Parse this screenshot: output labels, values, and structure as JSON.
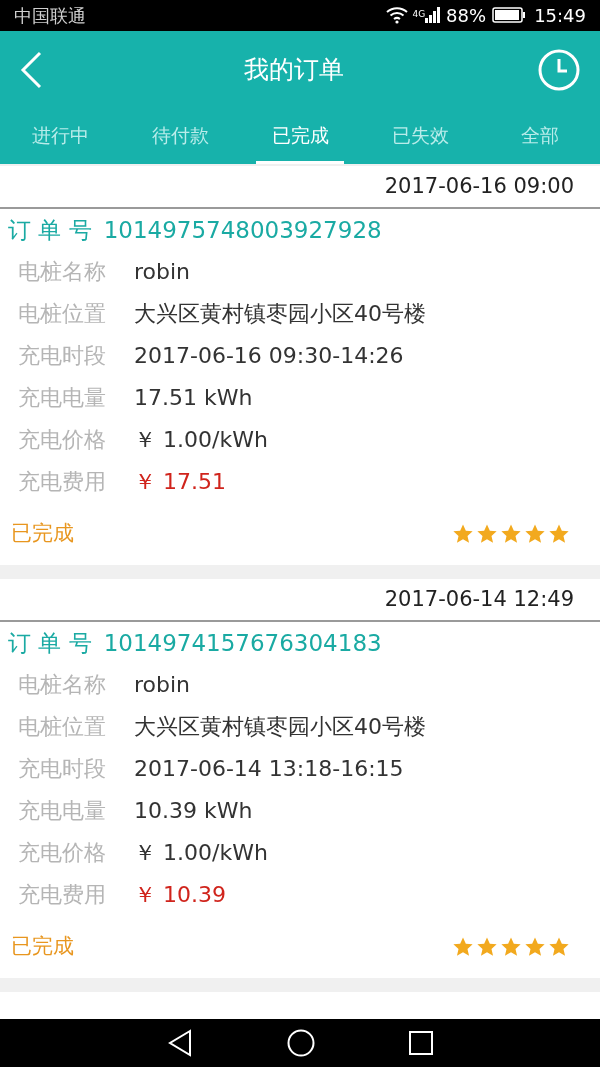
{
  "status_bar": {
    "carrier": "中国联通",
    "network": "4G",
    "battery": "88%",
    "time": "15:49"
  },
  "header": {
    "title": "我的订单"
  },
  "tabs": [
    {
      "label": "进行中",
      "selected": false
    },
    {
      "label": "待付款",
      "selected": false
    },
    {
      "label": "已完成",
      "selected": true
    },
    {
      "label": "已失效",
      "selected": false
    },
    {
      "label": "全部",
      "selected": false
    }
  ],
  "orders": [
    {
      "date": "2017-06-16 09:00",
      "order_label": "订 单 号",
      "order_number": "1014975748003927928",
      "fields": [
        {
          "label": "电桩名称",
          "value": "robin",
          "kind": "text"
        },
        {
          "label": "电桩位置",
          "value": "大兴区黄村镇枣园小区40号楼",
          "kind": "text"
        },
        {
          "label": "充电时段",
          "value": "2017-06-16 09:30-14:26",
          "kind": "text"
        },
        {
          "label": "充电电量",
          "value": "17.51 kWh",
          "kind": "text"
        },
        {
          "label": "充电价格",
          "value": "￥ 1.00/kWh",
          "kind": "text"
        },
        {
          "label": "充电费用",
          "value": "￥ 17.51",
          "kind": "cost"
        }
      ],
      "status": "已完成",
      "stars": 5
    },
    {
      "date": "2017-06-14 12:49",
      "order_label": "订 单 号",
      "order_number": "1014974157676304183",
      "fields": [
        {
          "label": "电桩名称",
          "value": "robin",
          "kind": "text"
        },
        {
          "label": "电桩位置",
          "value": "大兴区黄村镇枣园小区40号楼",
          "kind": "text"
        },
        {
          "label": "充电时段",
          "value": "2017-06-14 13:18-16:15",
          "kind": "text"
        },
        {
          "label": "充电电量",
          "value": "10.39 kWh",
          "kind": "text"
        },
        {
          "label": "充电价格",
          "value": "￥ 1.00/kWh",
          "kind": "text"
        },
        {
          "label": "充电费用",
          "value": "￥ 10.39",
          "kind": "cost"
        }
      ],
      "status": "已完成",
      "stars": 5
    }
  ]
}
